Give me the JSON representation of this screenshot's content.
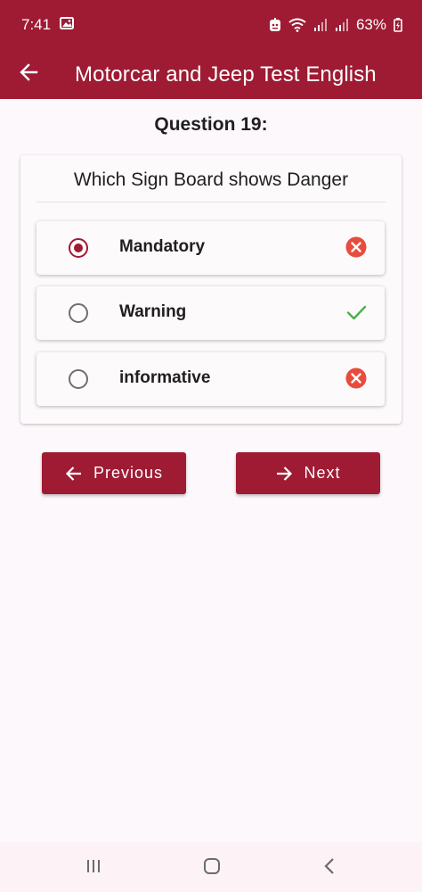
{
  "status_bar": {
    "time": "7:41",
    "battery": "63%",
    "icons": [
      "gallery-icon",
      "notification-icon",
      "wifi-icon",
      "signal-icon",
      "signal-icon",
      "battery-icon"
    ]
  },
  "app_bar": {
    "title": "Motorcar and Jeep Test English",
    "back_icon": "arrow-back-icon"
  },
  "question": {
    "number_label": "Question 19:",
    "text": "Which Sign Board shows Danger",
    "options": [
      {
        "label": "Mandatory",
        "selected": true,
        "result": "wrong"
      },
      {
        "label": "Warning",
        "selected": false,
        "result": "correct"
      },
      {
        "label": "informative",
        "selected": false,
        "result": "wrong"
      }
    ]
  },
  "navigation": {
    "previous_label": "Previous",
    "next_label": "Next"
  },
  "colors": {
    "primary": "#9e1b33",
    "wrong": "#e74c3c",
    "correct": "#4caf50"
  }
}
